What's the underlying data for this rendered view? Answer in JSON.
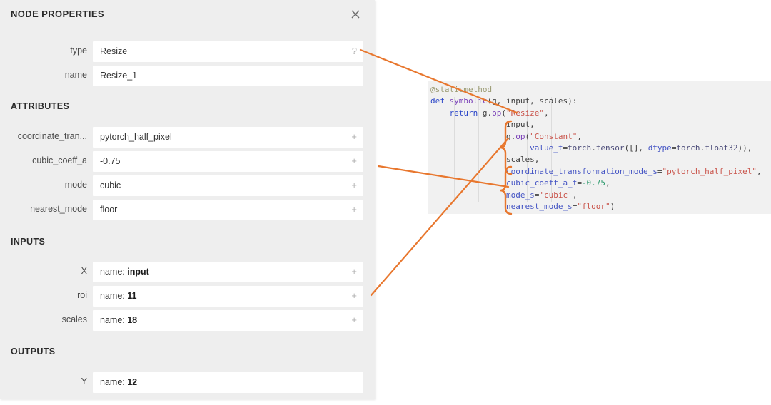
{
  "panel": {
    "title": "NODE PROPERTIES",
    "close_icon": "close-icon",
    "header_fields": [
      {
        "label": "type",
        "value": "Resize",
        "affix": "?"
      },
      {
        "label": "name",
        "value": "Resize_1",
        "affix": ""
      }
    ],
    "sections": [
      {
        "title": "ATTRIBUTES",
        "fields": [
          {
            "label": "coordinate_tran...",
            "value": "pytorch_half_pixel",
            "affix": "+"
          },
          {
            "label": "cubic_coeff_a",
            "value": "-0.75",
            "affix": "+"
          },
          {
            "label": "mode",
            "value": "cubic",
            "affix": "+"
          },
          {
            "label": "nearest_mode",
            "value": "floor",
            "affix": "+"
          }
        ]
      },
      {
        "title": "INPUTS",
        "fields": [
          {
            "label": "X",
            "value": "name: ",
            "bold": "input",
            "affix": "+"
          },
          {
            "label": "roi",
            "value": "name: ",
            "bold": "11",
            "affix": "+"
          },
          {
            "label": "scales",
            "value": "name: ",
            "bold": "18",
            "affix": "+"
          }
        ]
      },
      {
        "title": "OUTPUTS",
        "fields": [
          {
            "label": "Y",
            "value": "name: ",
            "bold": "12",
            "affix": ""
          }
        ]
      }
    ]
  },
  "code": {
    "language": "python",
    "lines": [
      "@staticmethod",
      "def symbolic(g, input, scales):",
      "    return g.op(\"Resize\",",
      "                input,",
      "                g.op(\"Constant\",",
      "                     value_t=torch.tensor([], dtype=torch.float32)),",
      "                scales,",
      "                coordinate_transformation_mode_s=\"pytorch_half_pixel\",",
      "                cubic_coeff_a_f=-0.75,",
      "                mode_s='cubic',",
      "                nearest_mode_s=\"floor\")"
    ]
  },
  "annotations": {
    "accent_color": "#e8772e",
    "brace_top_label": "inputs-brace",
    "brace_bottom_label": "attributes-brace",
    "connector_count": 3
  },
  "colors": {
    "panel_background": "#eeeeee",
    "field_background": "#ffffff",
    "code_background": "#f1f1f1",
    "accent": "#e8772e",
    "text": "#333333",
    "keyword": "#2b46c8",
    "function": "#7a40b8",
    "string": "#c9534a",
    "number": "#2e9b6e",
    "decorator": "#9a9a72"
  }
}
